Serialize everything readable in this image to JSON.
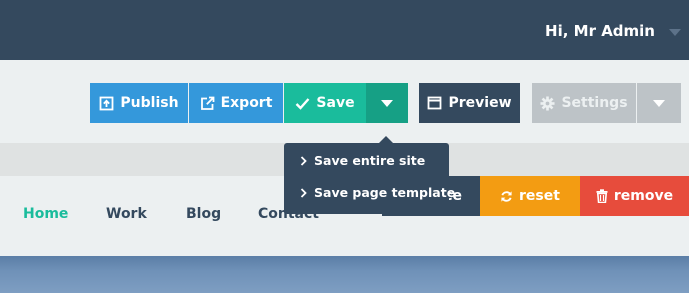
{
  "topbar": {
    "greeting": "Hi, Mr Admin"
  },
  "toolbar": {
    "publish_label": "Publish",
    "export_label": "Export",
    "save_label": "Save",
    "preview_label": "Preview",
    "settings_label": "Settings"
  },
  "save_dropdown": {
    "items": [
      {
        "label": "Save entire site"
      },
      {
        "label": "Save page template"
      }
    ]
  },
  "block_actions": {
    "replace_label_fragment": "ce",
    "reset_label": "reset",
    "remove_label": "remove"
  },
  "site_nav": {
    "items": [
      {
        "label": "Home",
        "active": true
      },
      {
        "label": "Work"
      },
      {
        "label": "Blog"
      },
      {
        "label": "Contact"
      }
    ]
  },
  "colors": {
    "topbar": "#34495e",
    "primary": "#3498db",
    "success": "#1abc9c",
    "warning": "#f39c12",
    "danger": "#e74c3c",
    "muted": "#bdc3c7"
  },
  "icons": {
    "publish": "upload-icon",
    "export": "external-link-icon",
    "save": "check-icon",
    "preview": "window-icon",
    "settings": "gear-icon",
    "reset": "refresh-icon",
    "remove": "trash-icon"
  }
}
